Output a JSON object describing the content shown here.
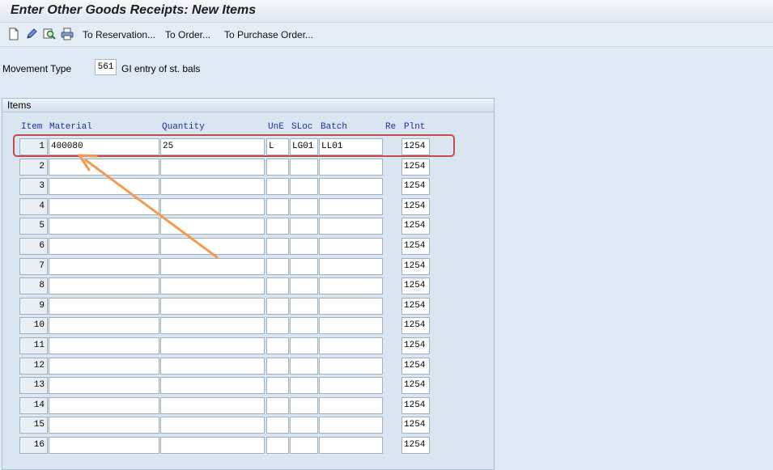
{
  "title": "Enter Other Goods Receipts: New Items",
  "toolbar": {
    "icons": [
      "new-document-icon",
      "pencil-icon",
      "display-icon",
      "print-icon"
    ],
    "buttons": [
      "To Reservation...",
      "To Order...",
      "To Purchase Order..."
    ]
  },
  "movement": {
    "label": "Movement Type",
    "value": "561",
    "description": "GI entry of st. bals"
  },
  "items_group": {
    "title": "Items",
    "columns": [
      "Item",
      "Material",
      "Quantity",
      "UnE",
      "SLoc",
      "Batch",
      "Re",
      "Plnt"
    ],
    "rows": [
      {
        "item": "1",
        "material": "400080",
        "quantity": "25",
        "une": "L",
        "sloc": "LG01",
        "batch": "LL01",
        "plnt": "1254"
      },
      {
        "item": "2",
        "material": "",
        "quantity": "",
        "une": "",
        "sloc": "",
        "batch": "",
        "plnt": "1254"
      },
      {
        "item": "3",
        "material": "",
        "quantity": "",
        "une": "",
        "sloc": "",
        "batch": "",
        "plnt": "1254"
      },
      {
        "item": "4",
        "material": "",
        "quantity": "",
        "une": "",
        "sloc": "",
        "batch": "",
        "plnt": "1254"
      },
      {
        "item": "5",
        "material": "",
        "quantity": "",
        "une": "",
        "sloc": "",
        "batch": "",
        "plnt": "1254"
      },
      {
        "item": "6",
        "material": "",
        "quantity": "",
        "une": "",
        "sloc": "",
        "batch": "",
        "plnt": "1254"
      },
      {
        "item": "7",
        "material": "",
        "quantity": "",
        "une": "",
        "sloc": "",
        "batch": "",
        "plnt": "1254"
      },
      {
        "item": "8",
        "material": "",
        "quantity": "",
        "une": "",
        "sloc": "",
        "batch": "",
        "plnt": "1254"
      },
      {
        "item": "9",
        "material": "",
        "quantity": "",
        "une": "",
        "sloc": "",
        "batch": "",
        "plnt": "1254"
      },
      {
        "item": "10",
        "material": "",
        "quantity": "",
        "une": "",
        "sloc": "",
        "batch": "",
        "plnt": "1254"
      },
      {
        "item": "11",
        "material": "",
        "quantity": "",
        "une": "",
        "sloc": "",
        "batch": "",
        "plnt": "1254"
      },
      {
        "item": "12",
        "material": "",
        "quantity": "",
        "une": "",
        "sloc": "",
        "batch": "",
        "plnt": "1254"
      },
      {
        "item": "13",
        "material": "",
        "quantity": "",
        "une": "",
        "sloc": "",
        "batch": "",
        "plnt": "1254"
      },
      {
        "item": "14",
        "material": "",
        "quantity": "",
        "une": "",
        "sloc": "",
        "batch": "",
        "plnt": "1254"
      },
      {
        "item": "15",
        "material": "",
        "quantity": "",
        "une": "",
        "sloc": "",
        "batch": "",
        "plnt": "1254"
      },
      {
        "item": "16",
        "material": "",
        "quantity": "",
        "une": "",
        "sloc": "",
        "batch": "",
        "plnt": "1254"
      }
    ]
  },
  "colors": {
    "background": "#dfe9f5",
    "header_text": "#1c2fa6",
    "highlight_border": "#c4494c",
    "annotation_arrow": "#f39a4c"
  }
}
